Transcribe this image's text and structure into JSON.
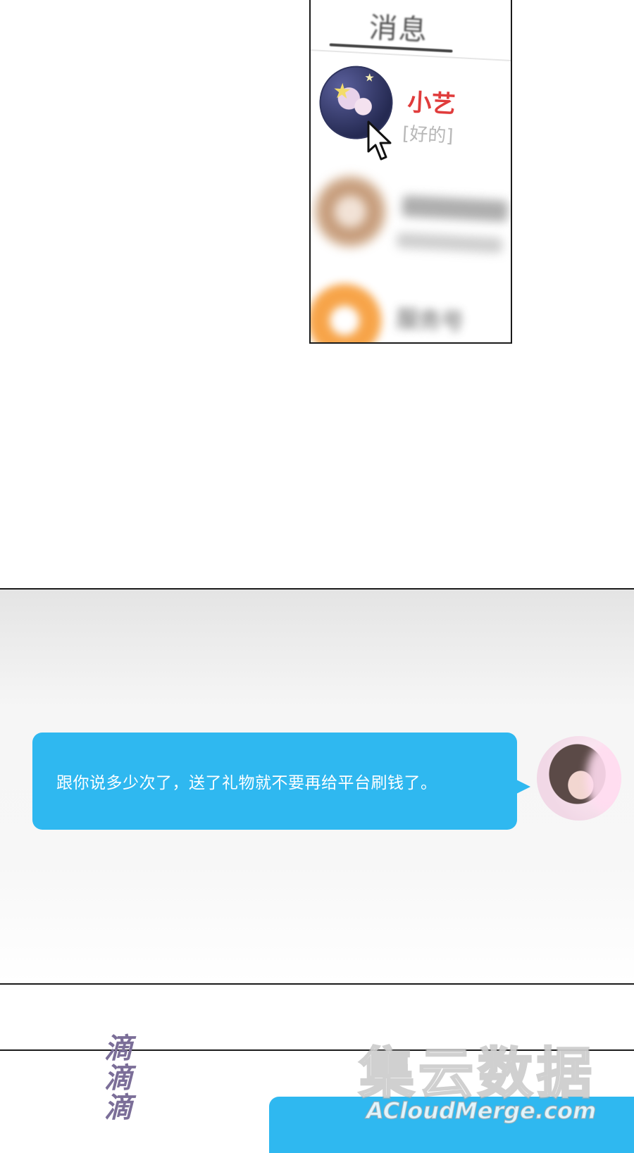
{
  "messages_screen": {
    "title": "消息",
    "contacts": [
      {
        "name": "小艺",
        "preview": "[好的]",
        "avatar_icon": "starry-girl-avatar-icon"
      },
      {
        "name": "",
        "preview": "",
        "avatar_icon": "girl-avatar-icon",
        "blurred": true
      },
      {
        "name": "服务号",
        "preview": "",
        "avatar_icon": "service-avatar-icon",
        "blurred": true
      }
    ],
    "pointer_icon": "cursor-arrow-icon",
    "colors": {
      "name": "#e03c3c",
      "preview": "#b8b8b8"
    }
  },
  "chat": {
    "message": "跟你说多少次了，送了礼物就不要再给平台刷钱了。",
    "avatar_icon": "woman-avatar-icon",
    "bubble_color": "#2fb8f0"
  },
  "sound_effect": [
    "滴",
    "滴",
    "滴"
  ],
  "watermark": {
    "logo": "集云数据",
    "url": "ACloudMerge.com"
  }
}
